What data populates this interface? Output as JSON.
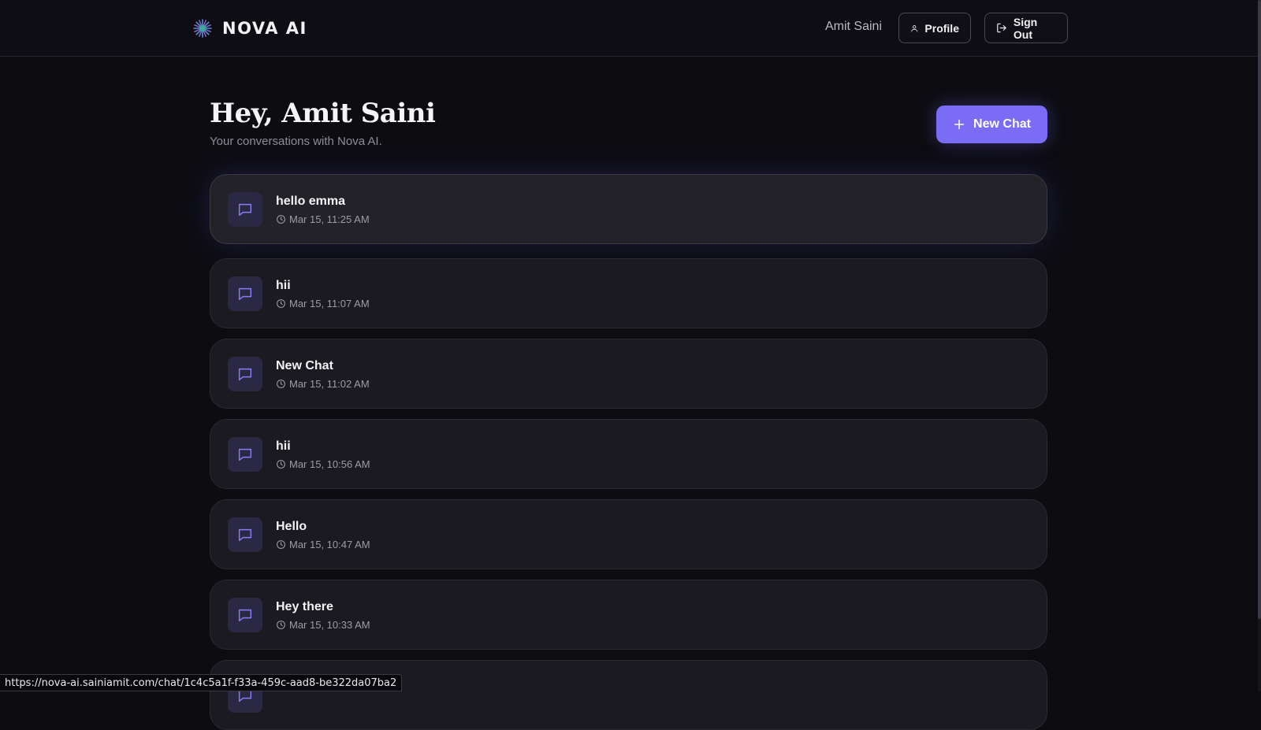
{
  "header": {
    "brand": "NOVA AI",
    "logo_icon": "starburst-logo-icon",
    "user_name": "Amit Saini",
    "profile_label": "Profile",
    "signout_label": "Sign Out"
  },
  "main": {
    "greeting": "Hey, Amit Saini",
    "subtitle": "Your conversations with Nova AI.",
    "new_chat_label": "New Chat"
  },
  "chats": [
    {
      "title": "hello emma",
      "time": "Mar 15, 11:25 AM",
      "active": true
    },
    {
      "title": "hii",
      "time": "Mar 15, 11:07 AM",
      "active": false
    },
    {
      "title": "New Chat",
      "time": "Mar 15, 11:02 AM",
      "active": false
    },
    {
      "title": "hii",
      "time": "Mar 15, 10:56 AM",
      "active": false
    },
    {
      "title": "Hello",
      "time": "Mar 15, 10:47 AM",
      "active": false
    },
    {
      "title": "Hey there",
      "time": "Mar 15, 10:33 AM",
      "active": false
    },
    {
      "title": "",
      "time": "",
      "active": false
    }
  ],
  "status_bar": {
    "url": "https://nova-ai.sainiamit.com/chat/1c4c5a1f-f33a-459c-aad8-be322da07ba2"
  },
  "colors": {
    "background": "#0c0c11",
    "accent": "#7b6cf6",
    "card": "#1a1a20",
    "icon_box": "#2b2843"
  }
}
